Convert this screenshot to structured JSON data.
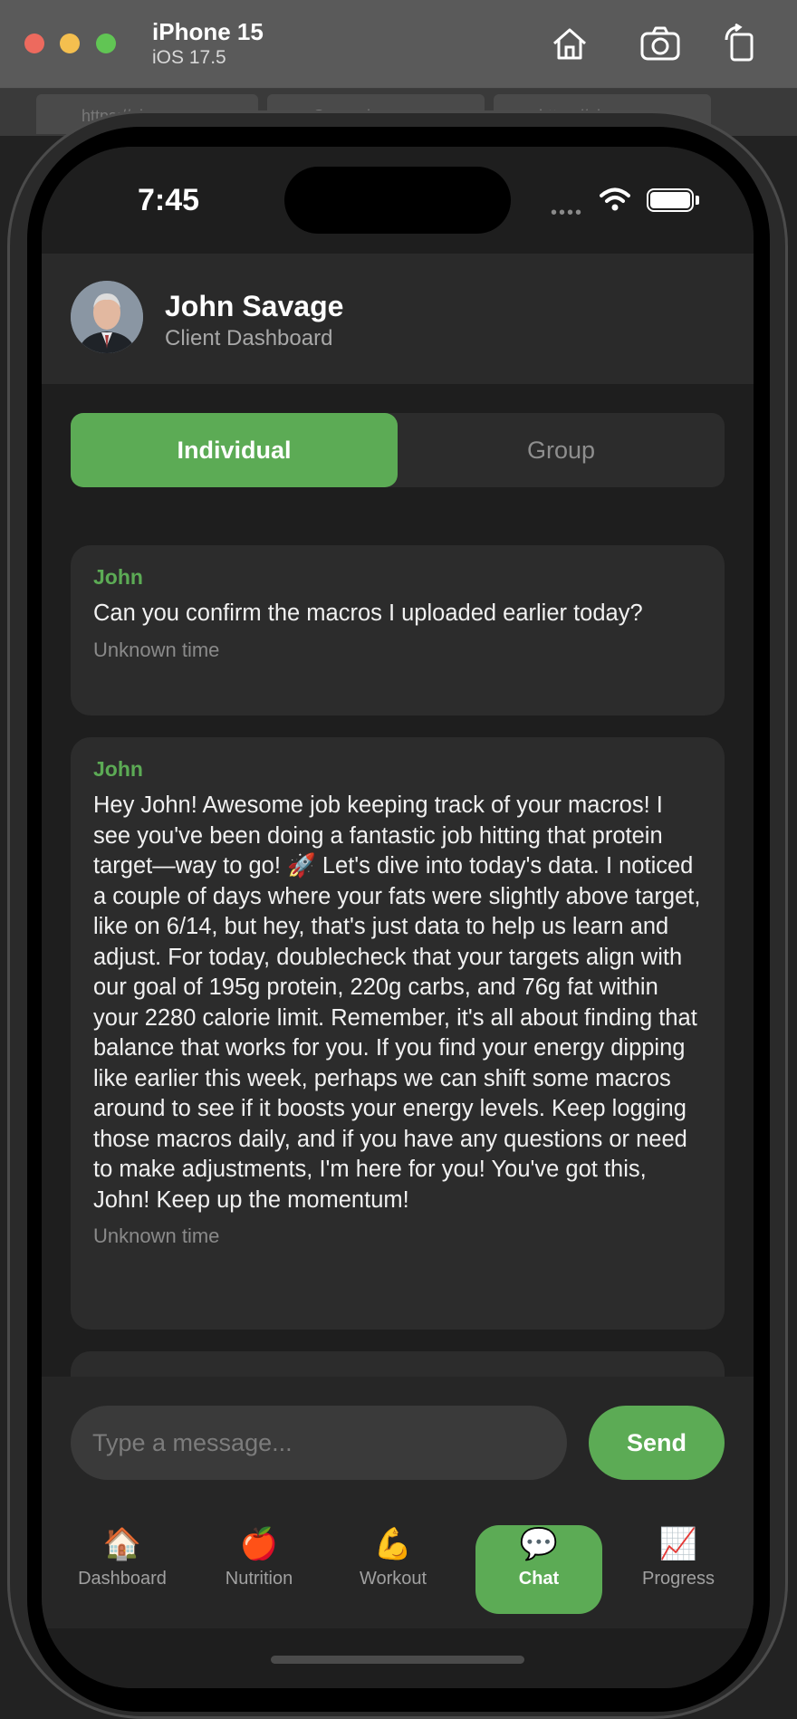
{
  "simulator": {
    "device_name": "iPhone 15",
    "os_version": "iOS 17.5"
  },
  "browser_tabs": [
    "https://ai-co...",
    "General",
    "https://ai-co..."
  ],
  "status_bar": {
    "time": "7:45"
  },
  "header": {
    "name": "John Savage",
    "subtitle": "Client Dashboard"
  },
  "segments": {
    "active": "Individual",
    "inactive": "Group"
  },
  "messages": [
    {
      "sender": "John",
      "text": "Can you confirm the macros I uploaded earlier today?",
      "time": "Unknown time"
    },
    {
      "sender": "John",
      "text": "Hey John! Awesome job keeping track of your macros! I see you've been doing a fantastic job hitting that protein target—way to go! 🚀 Let's dive into today's data. I noticed a couple of days where your fats were slightly above target, like on 6/14, but hey, that's just data to help us learn and adjust. For today, doublecheck that your targets align with our goal of 195g protein, 220g carbs, and 76g fat within your 2280 calorie limit. Remember, it's all about finding that balance that works for you. If you find your energy dipping like earlier this week, perhaps we can shift some macros around to see if it boosts your energy levels. Keep logging those macros daily, and if you have any questions or need to make adjustments, I'm here for you! You've got this, John! Keep up the momentum!",
      "time": "Unknown time"
    }
  ],
  "composer": {
    "placeholder": "Type a message...",
    "send_label": "Send"
  },
  "tabs": [
    {
      "icon": "🏠",
      "label": "Dashboard",
      "active": false
    },
    {
      "icon": "🍎",
      "label": "Nutrition",
      "active": false
    },
    {
      "icon": "💪",
      "label": "Workout",
      "active": false
    },
    {
      "icon": "💬",
      "label": "Chat",
      "active": true
    },
    {
      "icon": "📈",
      "label": "Progress",
      "active": false
    }
  ],
  "colors": {
    "accent": "#5cab55",
    "background": "#1e1e1e",
    "card": "#2c2c2c"
  }
}
